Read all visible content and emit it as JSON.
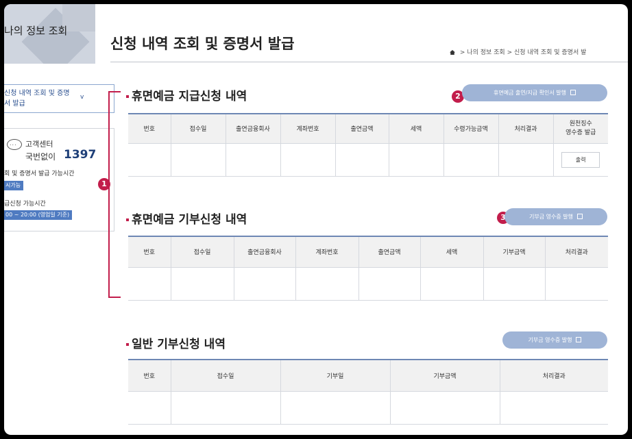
{
  "sidebar": {
    "title": "나의 정보 조회",
    "menu_label": "신청 내역 조회 및 증명서 발급",
    "menu_chevron": "v",
    "support": {
      "icon_glyph": "...",
      "label": "고객센터",
      "number_prefix": "국번없이",
      "number": "1397",
      "avail_text_1": "회 및 증명서 발급 가능시간",
      "badge_1": "시가능",
      "avail_text_2": "급신청 가능시간",
      "badge_2": "00 ~ 20:00 (영업일 기준)"
    }
  },
  "page": {
    "title": "신청 내역 조회 및 증명서 발급",
    "breadcrumb": [
      "나의 정보 조회",
      "신청 내역 조회 및 증명서 발"
    ],
    "breadcrumb_sep": ">"
  },
  "markers": [
    "1",
    "2",
    "3"
  ],
  "colors": {
    "accent": "#c21d4b",
    "pill": "#9fb4d6",
    "header_line": "#6d87b4",
    "badge": "#4f7bc1"
  },
  "sections": [
    {
      "title": "휴면예금 지급신청 내역",
      "button": "휴면예금 출연/지급 확인서 발행",
      "columns": [
        "번호",
        "접수일",
        "출연금융회사",
        "계좌번호",
        "출연금액",
        "세액",
        "수령가능금액",
        "처리결과",
        "원천징수\n영수증 발급"
      ],
      "row_action": "출력"
    },
    {
      "title": "휴면예금 기부신청 내역",
      "button": "기부금 영수증 발행",
      "columns": [
        "번호",
        "접수일",
        "출연금융회사",
        "계좌번호",
        "출연금액",
        "세액",
        "기부금액",
        "처리결과"
      ]
    },
    {
      "title": "일반 기부신청 내역",
      "button": "기부금 영수증 발행",
      "columns": [
        "번호",
        "접수일",
        "기부일",
        "기부금액",
        "처리결과"
      ]
    }
  ]
}
